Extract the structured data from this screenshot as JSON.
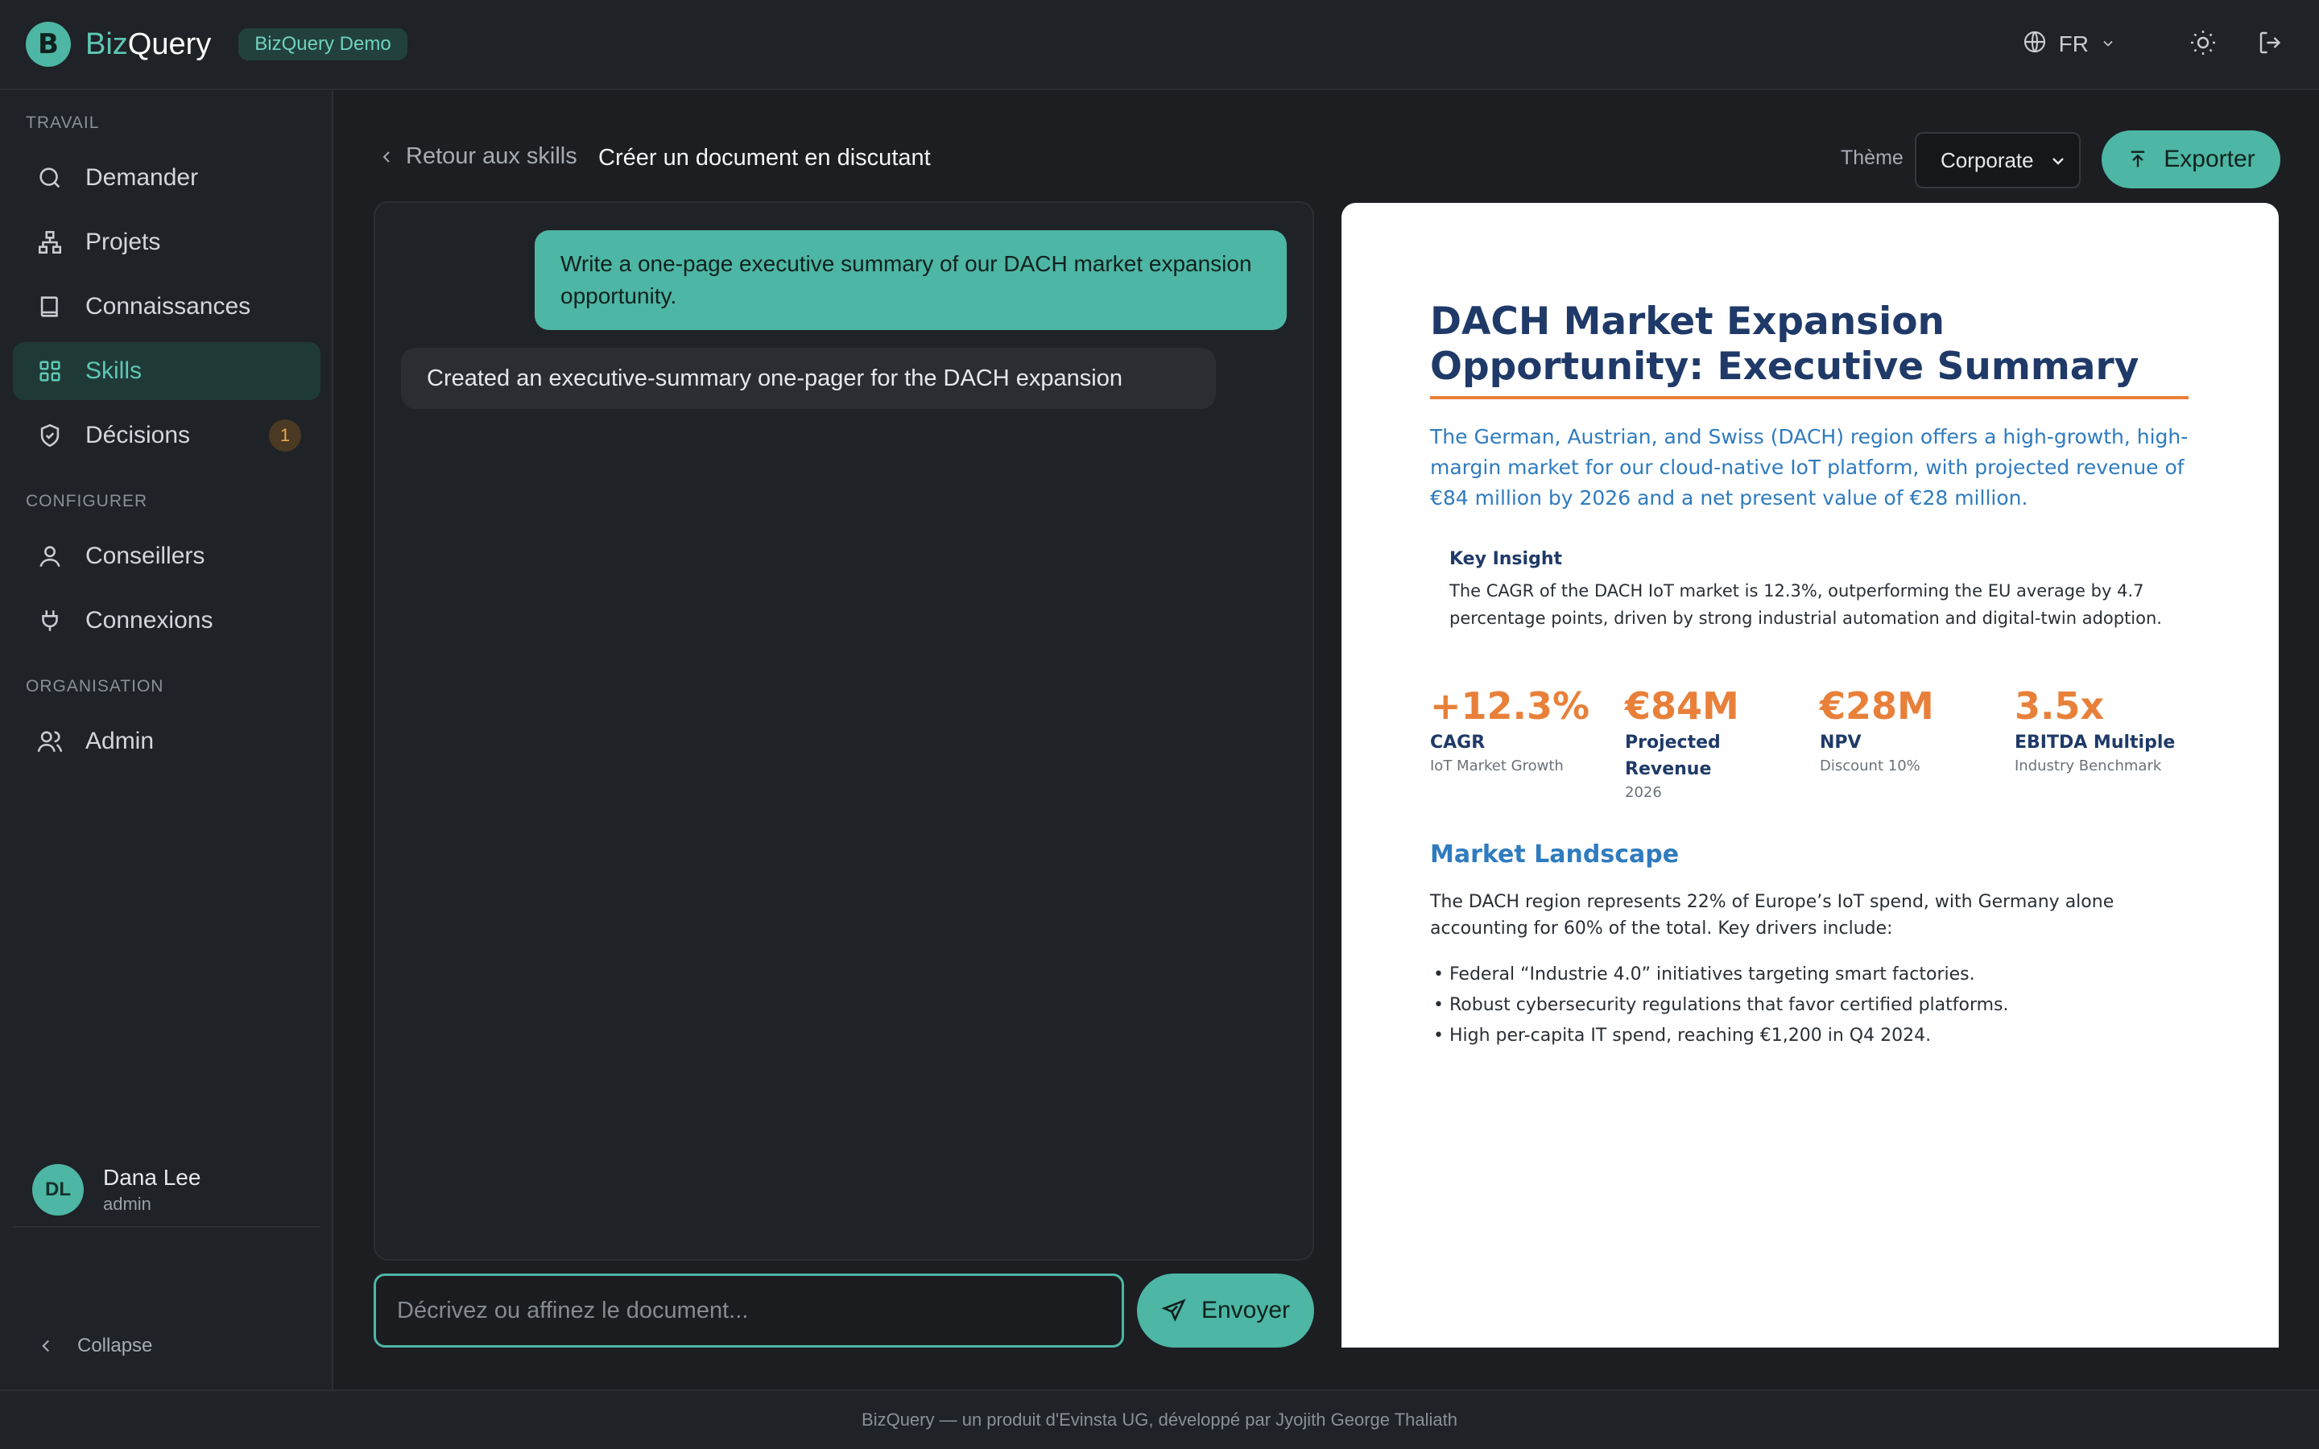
{
  "app": {
    "logo_letter": "B",
    "brand_part1": "Biz",
    "brand_part2": "Query",
    "demo_badge": "BizQuery Demo"
  },
  "header": {
    "language": "FR",
    "icons": [
      "globe-icon",
      "chevron-down-icon",
      "sun-icon",
      "logout-icon"
    ]
  },
  "sidebar": {
    "sections": [
      {
        "title": "TRAVAIL"
      },
      {
        "title": "CONFIGURER"
      },
      {
        "title": "ORGANISATION"
      }
    ],
    "items": [
      {
        "label": "Demander",
        "icon": "search-icon"
      },
      {
        "label": "Projets",
        "icon": "sitemap-icon"
      },
      {
        "label": "Connaissances",
        "icon": "book-icon"
      },
      {
        "label": "Skills",
        "icon": "grid-icon",
        "active": true
      },
      {
        "label": "Décisions",
        "icon": "shield-check-icon",
        "badge": "1"
      },
      {
        "label": "Conseillers",
        "icon": "user-icon"
      },
      {
        "label": "Connexions",
        "icon": "plug-icon"
      },
      {
        "label": "Admin",
        "icon": "users-icon"
      }
    ],
    "user": {
      "initials": "DL",
      "name": "Dana Lee",
      "role": "admin"
    },
    "collapse_label": "Collapse"
  },
  "main": {
    "back_label": "Retour aux skills",
    "title": "Créer un document en discutant",
    "theme_label": "Thème",
    "theme_value": "Corporate",
    "export_label": "Exporter"
  },
  "chat": {
    "user_message": "Write a one-page executive summary of our DACH market expansion opportunity.",
    "bot_message": "Created an executive-summary one-pager for the DACH expansion",
    "input_placeholder": "Décrivez ou affinez le document...",
    "send_label": "Envoyer"
  },
  "document": {
    "title": "DACH Market Expansion Opportunity: Executive Summary",
    "lead": "The German, Austrian, and Swiss (DACH) region offers a high-growth, high-margin market for our cloud-native IoT platform, with projected revenue of €84 million by 2026 and a net present value of €28 million.",
    "insight_heading": "Key Insight",
    "insight_text": "The CAGR of the DACH IoT market is 12.3%, outperforming the EU average by 4.7 percentage points, driven by strong industrial automation and digital-twin adoption.",
    "kpis": [
      {
        "value": "+12.3%",
        "label": "CAGR",
        "sub": "IoT Market Growth"
      },
      {
        "value": "€84M",
        "label": "Projected Revenue",
        "sub": "2026"
      },
      {
        "value": "€28M",
        "label": "NPV",
        "sub": "Discount 10%"
      },
      {
        "value": "3.5x",
        "label": "EBITDA Multiple",
        "sub": "Industry Benchmark"
      }
    ],
    "section_heading": "Market Landscape",
    "section_text": "The DACH region represents 22% of Europe’s IoT spend, with Germany alone accounting for 60% of the total. Key drivers include:",
    "bullets": [
      "• Federal “Industrie 4.0” initiatives targeting smart factories.",
      "• Robust cybersecurity regulations that favor certified platforms.",
      "• High per-capita IT spend, reaching €1,200 in Q4 2024."
    ]
  },
  "footer": {
    "text": "BizQuery — un produit d'Evinsta UG, développé par Jyojith George Thaliath"
  },
  "colors": {
    "accent": "#4db6a4",
    "background": "#1c1e22",
    "doc_navy": "#1f3a68",
    "doc_orange": "#e8803a",
    "doc_blue": "#2f7bbf"
  }
}
